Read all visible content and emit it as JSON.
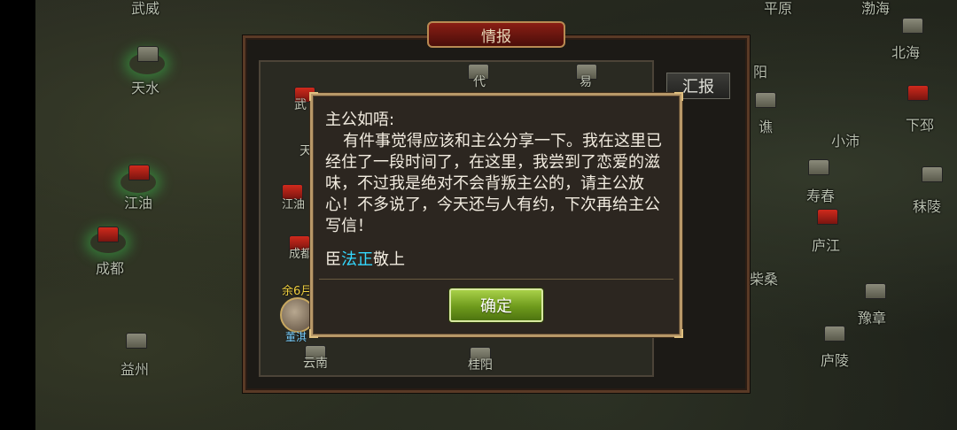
{
  "map": {
    "cities": [
      {
        "key": "wuwei",
        "label": "武威"
      },
      {
        "key": "pingyuan",
        "label": "平原"
      },
      {
        "key": "bohai",
        "label": "渤海"
      },
      {
        "key": "beihai",
        "label": "北海"
      },
      {
        "key": "tianshui",
        "label": "天水"
      },
      {
        "key": "yang",
        "label": "阳"
      },
      {
        "key": "qiao",
        "label": "谯"
      },
      {
        "key": "xiaopei",
        "label": "小沛"
      },
      {
        "key": "xiapi",
        "label": "下邳"
      },
      {
        "key": "jiangyou",
        "label": "江油"
      },
      {
        "key": "shouchun",
        "label": "寿春"
      },
      {
        "key": "moling",
        "label": "秣陵"
      },
      {
        "key": "chengdu",
        "label": "成都"
      },
      {
        "key": "lujiang",
        "label": "庐江"
      },
      {
        "key": "chaisang",
        "label": "柴桑"
      },
      {
        "key": "yuzhang",
        "label": "豫章"
      },
      {
        "key": "yizhou",
        "label": "益州"
      },
      {
        "key": "luling",
        "label": "庐陵"
      }
    ]
  },
  "panel": {
    "title": "情报",
    "report_button": "汇报",
    "cities": {
      "dai": "代",
      "yi": "易",
      "wu": "武",
      "tian": "天",
      "jiangyou": "江油",
      "chengdu": "成都",
      "yunnan": "云南",
      "guiyang": "桂阳"
    },
    "general": {
      "days": "余6月",
      "name": "董淇"
    }
  },
  "letter": {
    "greeting": "主公如唔:",
    "body": "有件事觉得应该和主公分享一下。我在这里已经住了一段时间了，在这里，我尝到了恋爱的滋味，不过我是绝对不会背叛主公的，请主公放心！不多说了，今天还与人有约，下次再给主公写信！",
    "sign_prefix": "臣",
    "sign_name": "法正",
    "sign_suffix": "敬上",
    "highlight_color": "#34d8ff",
    "ok_button": "确定"
  }
}
